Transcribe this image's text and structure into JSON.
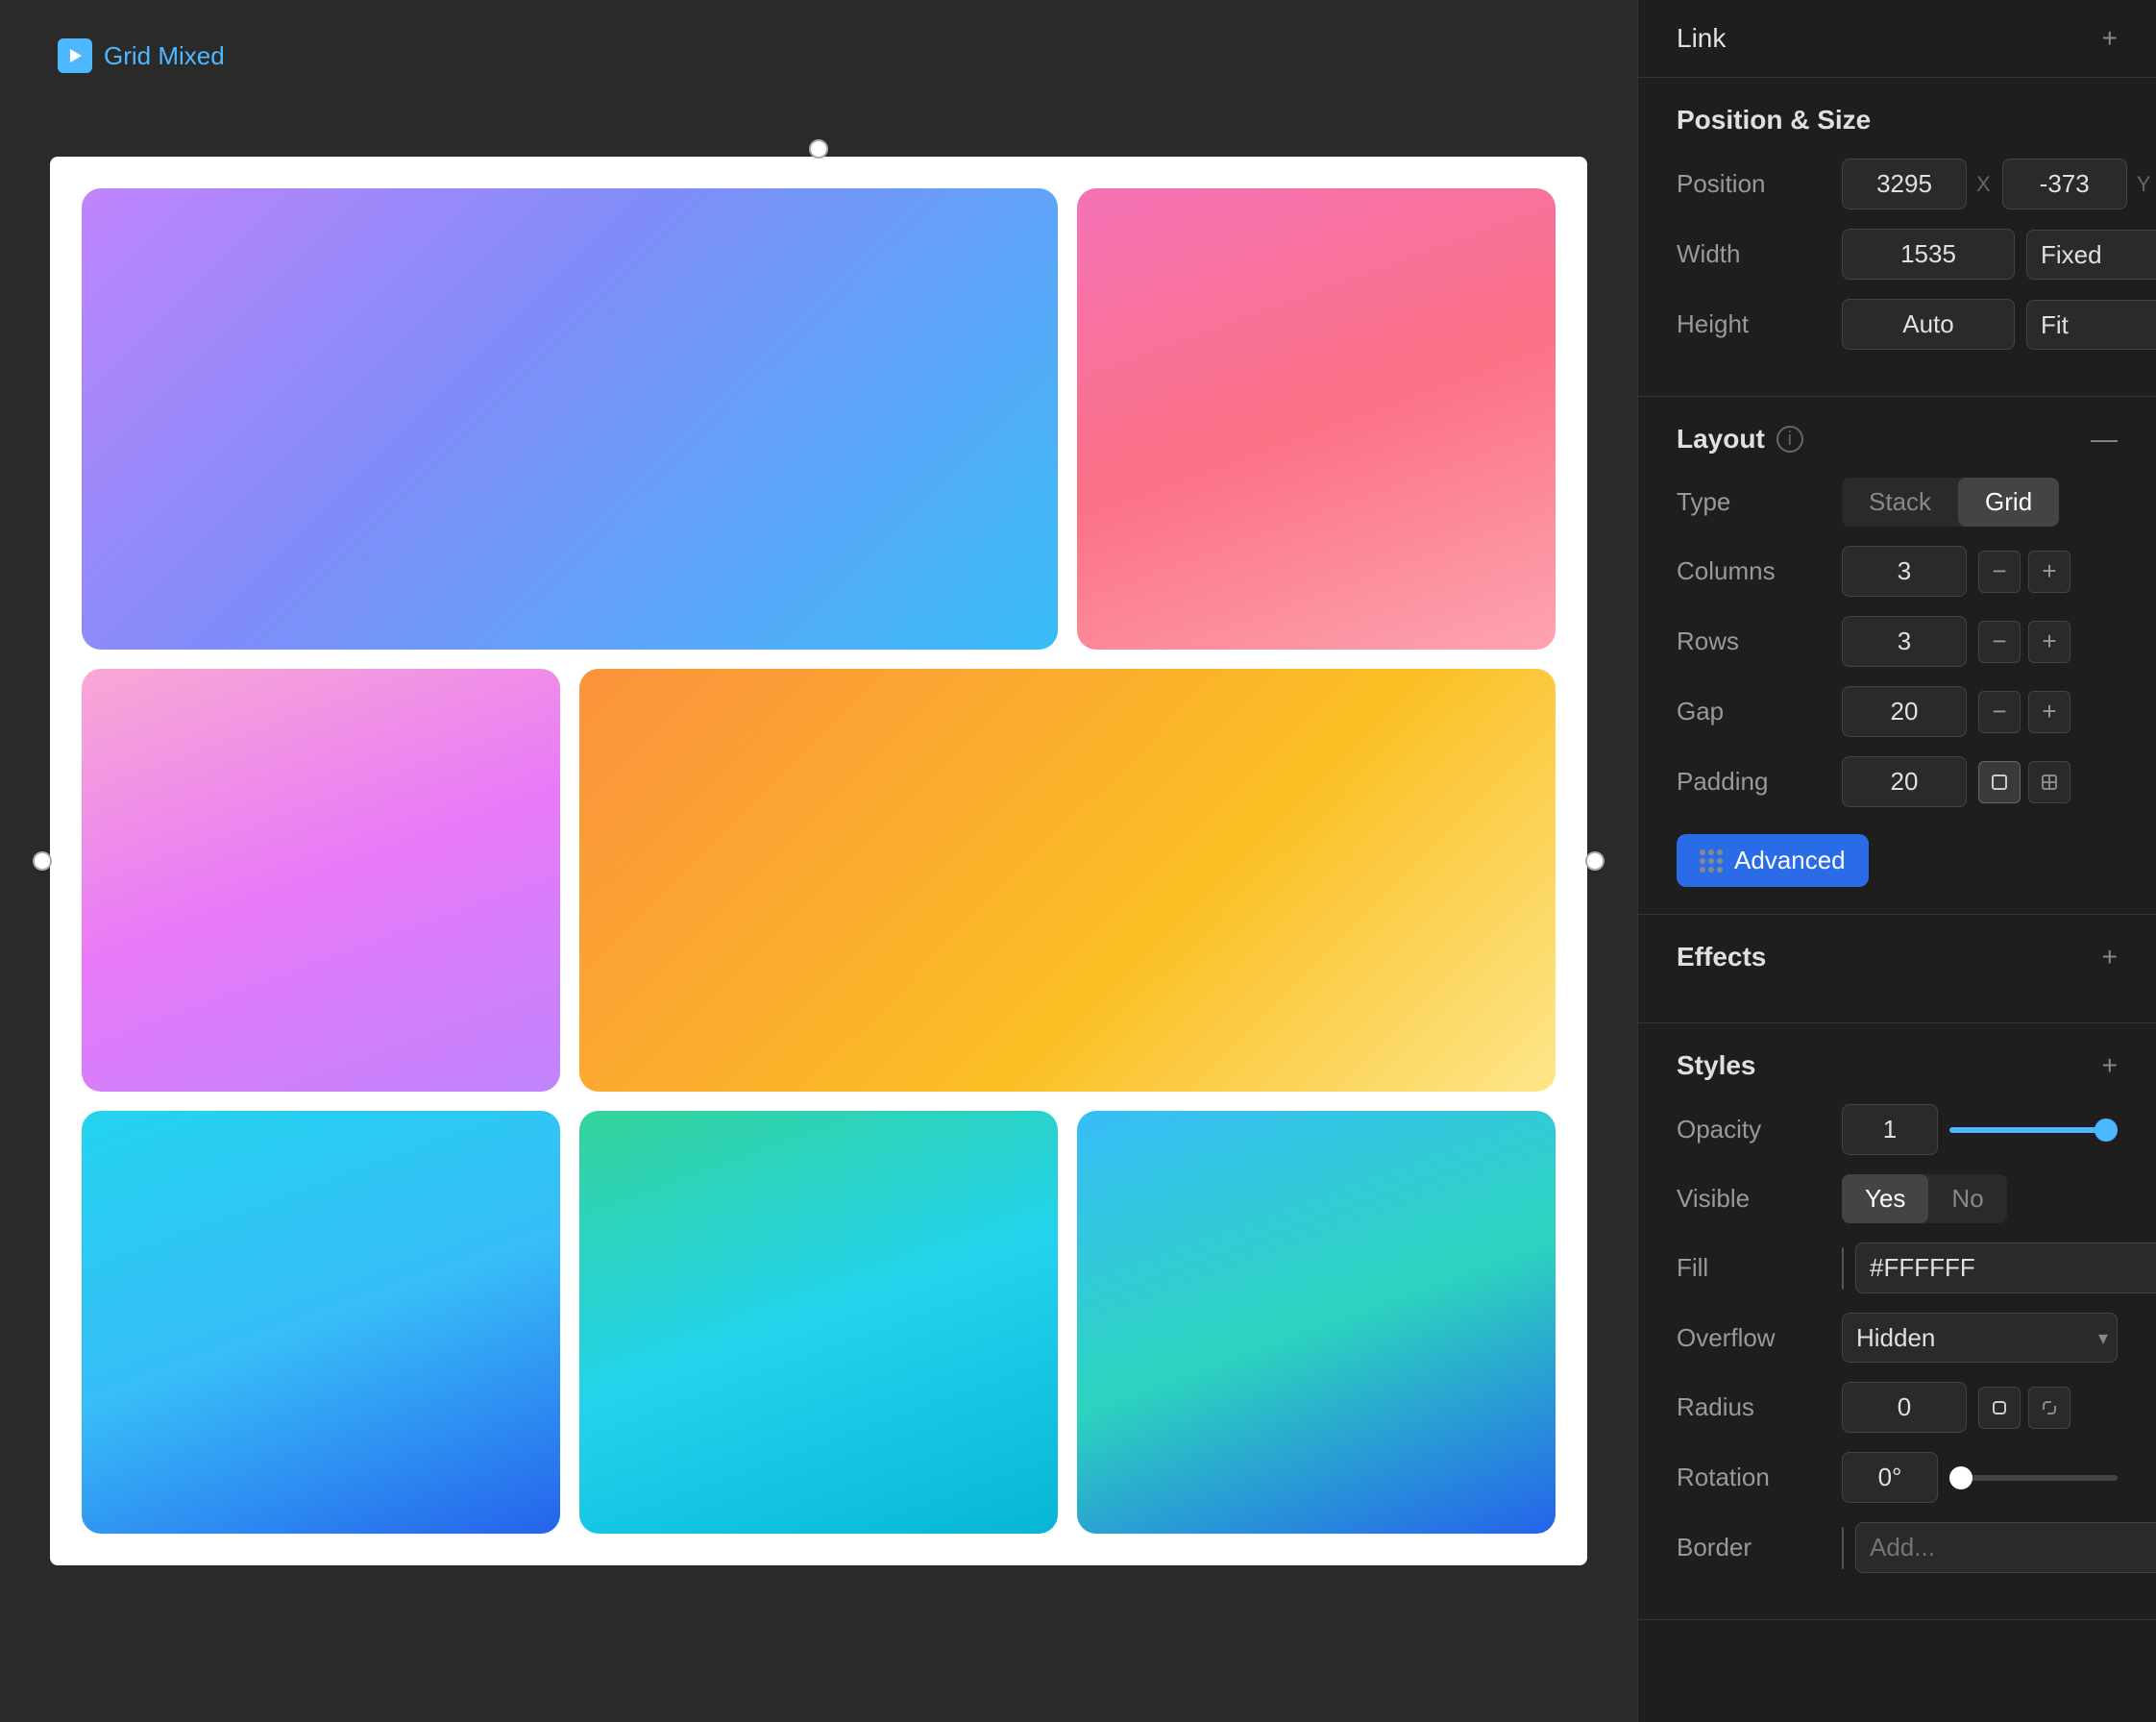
{
  "component": {
    "name": "Grid Mixed",
    "icon": "play-icon"
  },
  "canvas": {
    "grid_cells": [
      {
        "id": "cell-1",
        "span": "wide-top"
      },
      {
        "id": "cell-2",
        "span": "narrow-top"
      },
      {
        "id": "cell-3",
        "span": "narrow-mid"
      },
      {
        "id": "cell-4",
        "span": "wide-mid"
      },
      {
        "id": "cell-5",
        "span": "bottom-1"
      },
      {
        "id": "cell-6",
        "span": "bottom-2"
      },
      {
        "id": "cell-7",
        "span": "bottom-3"
      }
    ]
  },
  "panel": {
    "link": {
      "title": "Link",
      "add_label": "+"
    },
    "position_size": {
      "title": "Position & Size",
      "position_label": "Position",
      "position_x": "3295",
      "position_x_unit": "X",
      "position_y": "-373",
      "position_y_unit": "Y",
      "width_label": "Width",
      "width_value": "1535",
      "width_constraint": "Fixed",
      "height_label": "Height",
      "height_value": "Auto",
      "height_constraint": "Fit"
    },
    "layout": {
      "title": "Layout",
      "type_label": "Type",
      "type_stack": "Stack",
      "type_grid": "Grid",
      "columns_label": "Columns",
      "columns_value": "3",
      "rows_label": "Rows",
      "rows_value": "3",
      "gap_label": "Gap",
      "gap_value": "20",
      "padding_label": "Padding",
      "padding_value": "20",
      "advanced_label": "Advanced"
    },
    "effects": {
      "title": "Effects",
      "add_label": "+"
    },
    "styles": {
      "title": "Styles",
      "add_label": "+",
      "opacity_label": "Opacity",
      "opacity_value": "1",
      "opacity_percent": 100,
      "visible_label": "Visible",
      "visible_yes": "Yes",
      "visible_no": "No",
      "fill_label": "Fill",
      "fill_color": "#FFFFFF",
      "fill_hex": "#FFFFFF",
      "overflow_label": "Overflow",
      "overflow_value": "Hidden",
      "radius_label": "Radius",
      "radius_value": "0",
      "rotation_label": "Rotation",
      "rotation_value": "0°",
      "border_label": "Border",
      "border_placeholder": "Add..."
    }
  }
}
